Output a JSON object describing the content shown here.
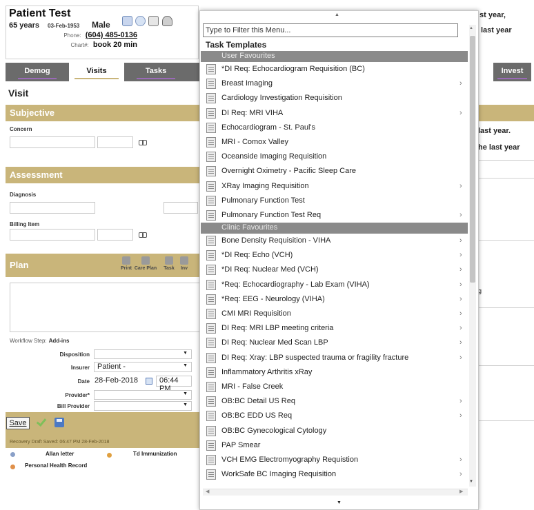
{
  "patient": {
    "name": "Patient Test",
    "age": "65 years",
    "dob": "03-Feb-1953",
    "sex": "Male",
    "phone_label": "Phone:",
    "phone": "(604) 485-0136",
    "chart_label": "Chart#:",
    "chart": "book 20 min"
  },
  "tabs": [
    "Demog",
    "Visits",
    "Tasks",
    "Invest"
  ],
  "visit_title": "Visit",
  "sections": {
    "subjective": "Subjective",
    "assessment": "Assessment",
    "plan": "Plan"
  },
  "fields": {
    "concern": "Concern",
    "diagnosis": "Diagnosis",
    "billing_item": "Billing Item"
  },
  "plan_tools": [
    "Print",
    "Care Plan",
    "Task",
    "Inv"
  ],
  "workflow": {
    "label": "Workflow Step:",
    "addins": "Add-ins"
  },
  "form": {
    "disposition_label": "Disposition",
    "insurer_label": "Insurer",
    "insurer_value": "Patient -",
    "date_label": "Date",
    "date_value": "28-Feb-2018",
    "time_value": "06:44 PM",
    "provider_label": "Provider*",
    "bill_provider_label": "Bill Provider"
  },
  "save_label": "Save",
  "recovery_text": "Recovery Draft Saved: 06:47 PM 28-Feb-2018",
  "bottom_links": [
    "Allan letter",
    "Td Immunization",
    "Personal Health Record"
  ],
  "background_right": [
    "st year,",
    "last year",
    "last year.",
    "he last year",
    "g"
  ],
  "popup": {
    "filter_placeholder": "Type to Filter this Menu...",
    "title": "Task Templates",
    "user_group": "User Favourites",
    "clinic_group": "Clinic Favourites",
    "user_items": [
      {
        "label": "*DI Req: Echocardiogram Requisition (BC)",
        "arrow": false
      },
      {
        "label": "Breast Imaging",
        "arrow": true
      },
      {
        "label": "Cardiology Investigation Requisition",
        "arrow": false
      },
      {
        "label": "DI Req: MRI VIHA",
        "arrow": true
      },
      {
        "label": "Echocardiogram - St. Paul's",
        "arrow": false
      },
      {
        "label": "MRI - Comox Valley",
        "arrow": false
      },
      {
        "label": "Oceanside Imaging Requisition",
        "arrow": false
      },
      {
        "label": "Overnight Oximetry - Pacific Sleep Care",
        "arrow": false
      },
      {
        "label": "XRay Imaging Requisition",
        "arrow": true
      },
      {
        "label": "Pulmonary Function Test",
        "arrow": false
      },
      {
        "label": "Pulmonary Function Test Req",
        "arrow": true
      }
    ],
    "clinic_items": [
      {
        "label": "Bone Density Requisition - VIHA",
        "arrow": true
      },
      {
        "label": "*DI Req: Echo (VCH)",
        "arrow": true
      },
      {
        "label": "*DI Req: Nuclear Med (VCH)",
        "arrow": true
      },
      {
        "label": "*Req: Echocardiography - Lab Exam (VIHA)",
        "arrow": true
      },
      {
        "label": "*Req: EEG - Neurology (VIHA)",
        "arrow": true
      },
      {
        "label": "CMI MRI Requisition",
        "arrow": true
      },
      {
        "label": "DI Req: MRI LBP meeting criteria",
        "arrow": true
      },
      {
        "label": "DI Req: Nuclear Med Scan LBP",
        "arrow": true
      },
      {
        "label": "DI Req: Xray: LBP suspected trauma or fragility fracture",
        "arrow": true
      },
      {
        "label": "Inflammatory Arthritis xRay",
        "arrow": false
      },
      {
        "label": "MRI - False Creek",
        "arrow": false
      },
      {
        "label": "OB:BC Detail US Req",
        "arrow": true
      },
      {
        "label": "OB:BC EDD US Req",
        "arrow": true
      },
      {
        "label": "OB:BC Gynecological Cytology",
        "arrow": false
      },
      {
        "label": "PAP Smear",
        "arrow": false
      },
      {
        "label": "VCH EMG Electromyography Requistion",
        "arrow": true
      },
      {
        "label": "WorkSafe BC Imaging Requisition",
        "arrow": true
      }
    ]
  },
  "colors": {
    "section_gold": "#c9b57a",
    "tab_gray": "#6b6b6b",
    "group_gray": "#8a8a8a"
  }
}
